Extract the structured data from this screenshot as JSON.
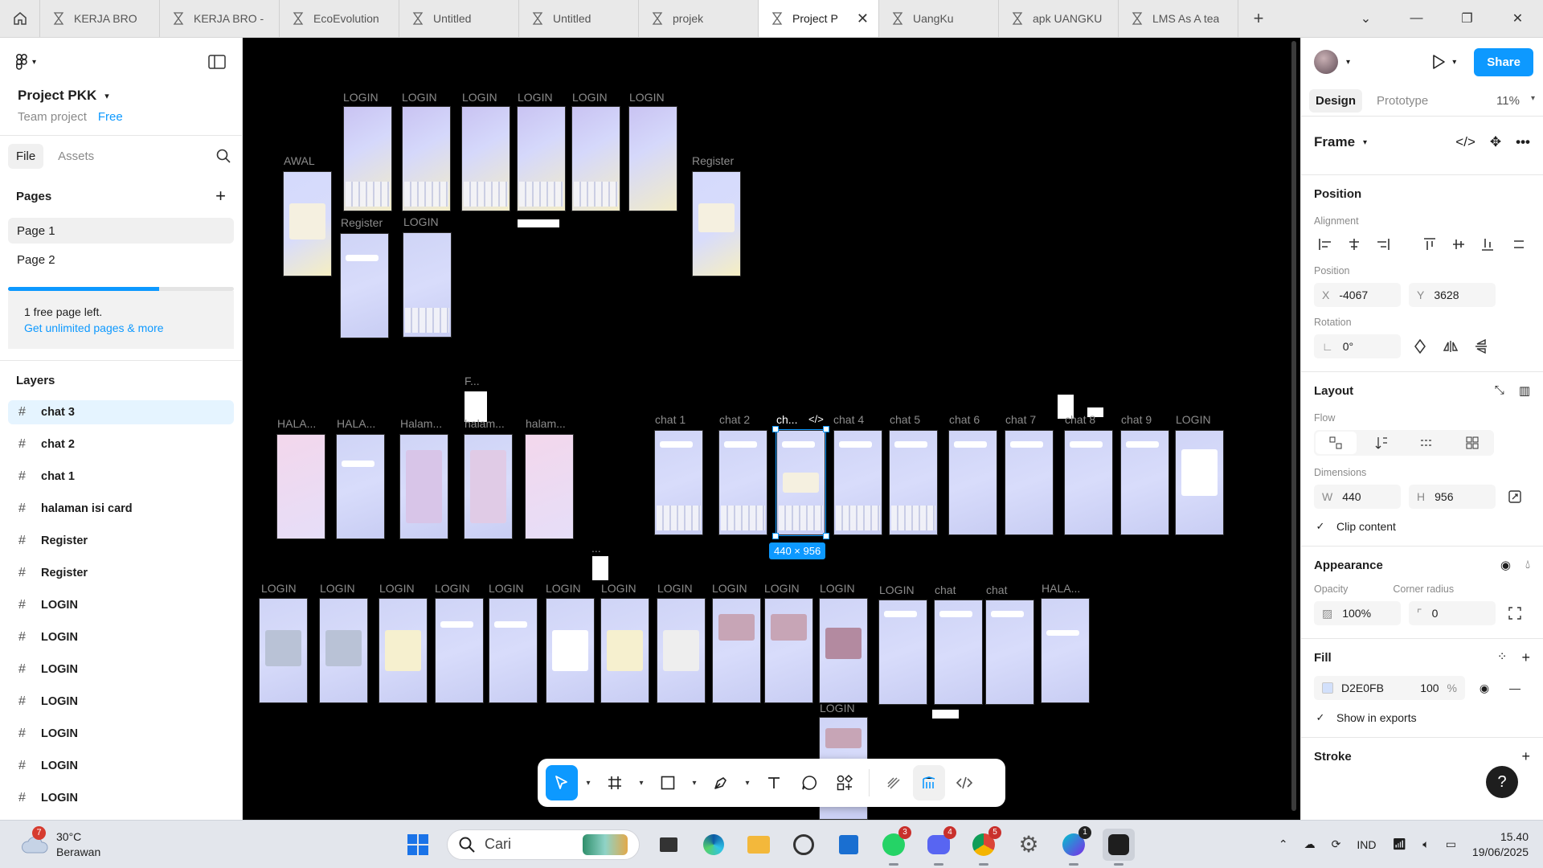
{
  "browser": {
    "tabs": [
      {
        "label": "KERJA BRO",
        "active": false
      },
      {
        "label": "KERJA BRO -",
        "active": false
      },
      {
        "label": "EcoEvolution",
        "active": false
      },
      {
        "label": "Untitled",
        "active": false
      },
      {
        "label": "Untitled",
        "active": false
      },
      {
        "label": "projek",
        "active": false
      },
      {
        "label": "Project P",
        "active": true
      },
      {
        "label": "UangKu",
        "active": false
      },
      {
        "label": "apk UANGKU",
        "active": false
      },
      {
        "label": "LMS As A tea",
        "active": false
      }
    ]
  },
  "left_panel": {
    "project_name": "Project PKK",
    "team": "Team project",
    "plan": "Free",
    "file_tab": "File",
    "assets_tab": "Assets",
    "pages_title": "Pages",
    "pages": [
      "Page 1",
      "Page 2"
    ],
    "pages_used_fraction": 0.67,
    "upsell_text": "1 free page left.",
    "upsell_link": "Get unlimited pages & more",
    "layers_title": "Layers",
    "layers": [
      "chat 3",
      "chat 2",
      "chat 1",
      "halaman isi card",
      "Register",
      "Register",
      "LOGIN",
      "LOGIN",
      "LOGIN",
      "LOGIN",
      "LOGIN",
      "LOGIN",
      "LOGIN"
    ]
  },
  "canvas": {
    "labels": {
      "awal": "AWAL",
      "login": "LOGIN",
      "register": "Register",
      "hala": "HALA...",
      "halam": "Halam...",
      "halam2": "halam...",
      "halaman": "halam...",
      "f": "F...",
      "ellipsis": "...",
      "chat1": "chat 1",
      "chat2": "chat 2",
      "ch": "ch...",
      "chat4": "chat 4",
      "chat5": "chat 5",
      "chat6": "chat 6",
      "chat7": "chat 7",
      "chat8": "chat 8",
      "chat9": "chat 9",
      "chat": "chat"
    },
    "selection_size": "440 × 956"
  },
  "right_panel": {
    "design_tab": "Design",
    "prototype_tab": "Prototype",
    "zoom": "11%",
    "share": "Share",
    "frame_label": "Frame",
    "position_title": "Position",
    "alignment_label": "Alignment",
    "position_label": "Position",
    "x_label": "X",
    "x_value": "-4067",
    "y_label": "Y",
    "y_value": "3628",
    "rotation_label": "Rotation",
    "rotation_value": "0°",
    "layout_title": "Layout",
    "flow_label": "Flow",
    "dimensions_label": "Dimensions",
    "w_label": "W",
    "w_value": "440",
    "h_label": "H",
    "h_value": "956",
    "clip_content": "Clip content",
    "appearance_title": "Appearance",
    "opacity_label": "Opacity",
    "opacity_value": "100%",
    "corner_label": "Corner radius",
    "corner_value": "0",
    "fill_title": "Fill",
    "fill_hex": "D2E0FB",
    "fill_opacity": "100",
    "percent": "%",
    "show_exports": "Show in exports",
    "stroke_title": "Stroke"
  },
  "taskbar": {
    "weather_badge": "7",
    "temperature": "30°C",
    "condition": "Berawan",
    "search": "Cari",
    "badges": {
      "whatsapp": "3",
      "discord": "4",
      "chrome": "5",
      "canva": "1"
    },
    "language": "IND",
    "time": "15.40",
    "date": "19/06/2025"
  },
  "colors": {
    "accent": "#0d99ff",
    "fill": "#D2E0FB"
  }
}
